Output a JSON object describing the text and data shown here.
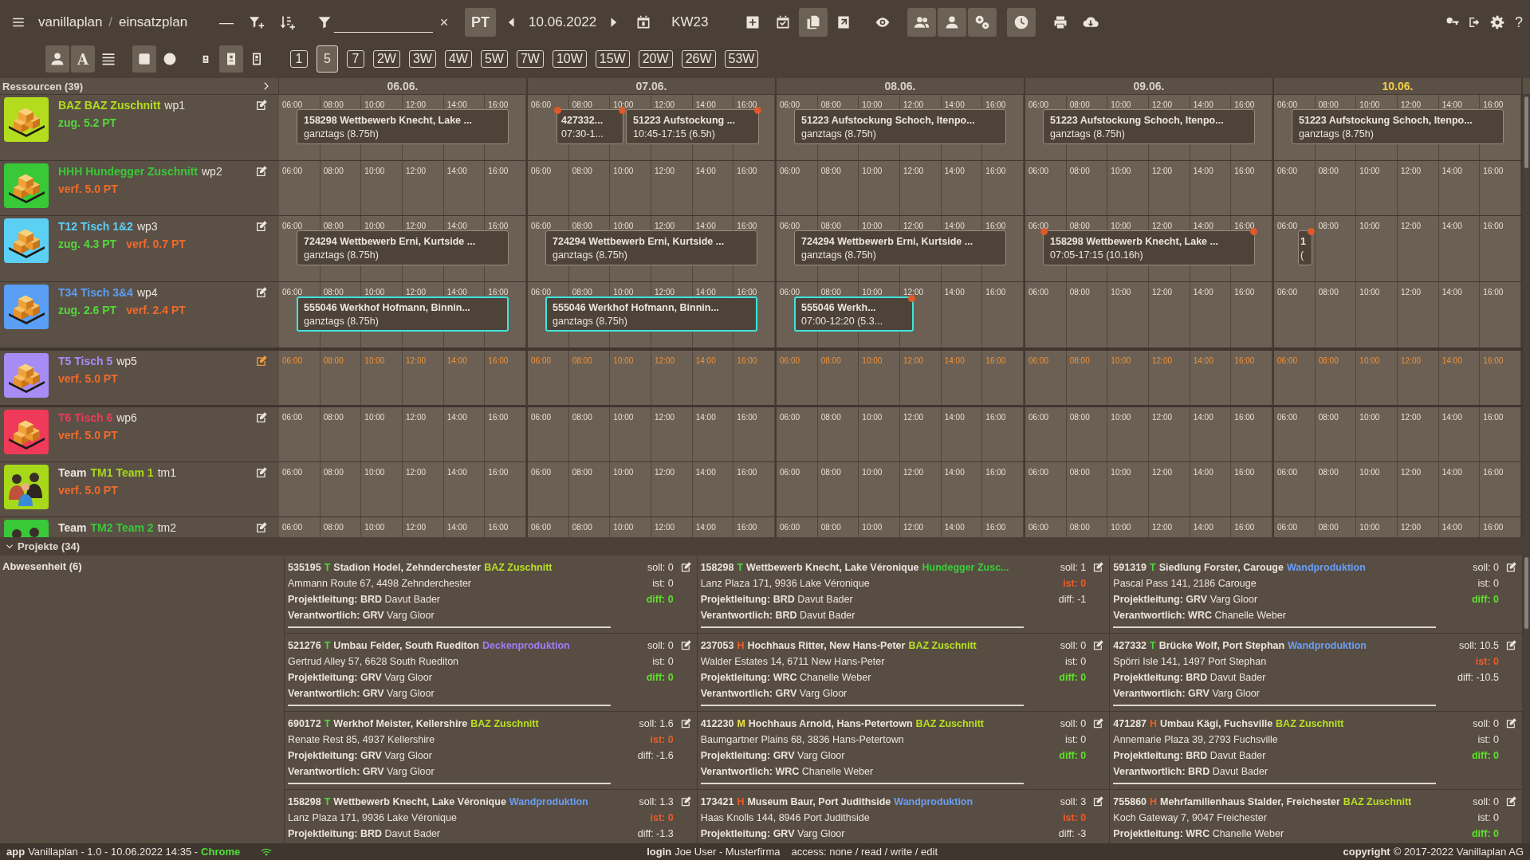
{
  "toolbar": {
    "breadcrumb": [
      "vanillaplan",
      "einsatzplan"
    ],
    "separator": "/",
    "collapse": "—",
    "clear": "×",
    "pt_button": {
      "label": "PT",
      "selected": true
    },
    "date": "10.06.2022",
    "week": "KW23",
    "tools": [
      {
        "kind": "plus-square",
        "selected": false
      },
      {
        "kind": "task-calendar",
        "selected": false
      },
      {
        "kind": "copy",
        "selected": true
      },
      {
        "kind": "share-square",
        "selected": false
      },
      {
        "kind": "eye",
        "selected": false
      },
      {
        "kind": "users",
        "selected": true
      },
      {
        "kind": "user",
        "selected": true
      },
      {
        "kind": "gears",
        "selected": true
      },
      {
        "kind": "clock",
        "selected": true
      },
      {
        "kind": "printer",
        "selected": false
      },
      {
        "kind": "cloud-download",
        "selected": false
      }
    ],
    "help": "?",
    "views": [
      {
        "kind": "user",
        "selected": true
      },
      {
        "kind": "letter",
        "label": "A",
        "selected": true
      },
      {
        "kind": "lines",
        "selected": false
      },
      {
        "kind": "square",
        "selected": true
      },
      {
        "kind": "circle",
        "selected": false
      },
      {
        "kind": "badge-small",
        "selected": false
      },
      {
        "kind": "badge",
        "selected": true
      },
      {
        "kind": "badge-outline",
        "selected": false
      }
    ],
    "ranges": [
      {
        "label": "1",
        "selected": false
      },
      {
        "label": "5",
        "selected": true
      },
      {
        "label": "7",
        "selected": false
      },
      {
        "label": "2W",
        "selected": false
      },
      {
        "label": "3W",
        "selected": false
      },
      {
        "label": "4W",
        "selected": false
      },
      {
        "label": "5W",
        "selected": false
      },
      {
        "label": "7W",
        "selected": false
      },
      {
        "label": "10W",
        "selected": false
      },
      {
        "label": "15W",
        "selected": false
      },
      {
        "label": "20W",
        "selected": false
      },
      {
        "label": "26W",
        "selected": false
      },
      {
        "label": "53W",
        "selected": false
      }
    ]
  },
  "schedule": {
    "resources_title": "Ressourcen (39)",
    "days": [
      {
        "label": "06.06.",
        "today": false
      },
      {
        "label": "07.06.",
        "today": false
      },
      {
        "label": "08.06.",
        "today": false
      },
      {
        "label": "09.06.",
        "today": false
      },
      {
        "label": "10.06.",
        "today": true
      }
    ],
    "resources": [
      {
        "kind": "pallet",
        "name": "BAZ BAZ Zuschnitt",
        "id": "wp1",
        "color": "#b3dc1e",
        "highlighted": false,
        "stats": [
          {
            "text": "zug. 5.2 PT",
            "kind": "zug"
          }
        ],
        "cells": [
          {
            "times": [
              "06:00",
              "08:00",
              "10:00",
              "12:00",
              "14:00",
              "16:00"
            ],
            "bookings": [
              {
                "title": "158298 Wettbewerb Knecht, Lake ...",
                "time": "ganztags (8.75h)",
                "kind": "full",
                "selected": false,
                "conflict_start": false,
                "conflict_end": false
              }
            ]
          },
          {
            "times": [
              "06:00",
              "08:00",
              "10:00",
              "12:00",
              "14:00",
              "16:00"
            ],
            "bookings": [
              {
                "title": "427332...",
                "time": "07:30-1...",
                "kind": "narrow",
                "selected": false,
                "conflict_start": true,
                "conflict_end": true
              },
              {
                "title": "51223 Aufstockung ...",
                "time": "10:45-17:15 (6.5h)",
                "kind": "wide",
                "selected": false,
                "conflict_start": false,
                "conflict_end": true
              }
            ]
          },
          {
            "times": [
              "06:00",
              "08:00",
              "10:00",
              "12:00",
              "14:00",
              "16:00"
            ],
            "bookings": [
              {
                "title": "51223 Aufstockung Schoch, Itenpo...",
                "time": "ganztags (8.75h)",
                "kind": "full",
                "selected": false,
                "conflict_start": false,
                "conflict_end": false
              }
            ]
          },
          {
            "times": [
              "06:00",
              "08:00",
              "10:00",
              "12:00",
              "14:00",
              "16:00"
            ],
            "bookings": [
              {
                "title": "51223 Aufstockung Schoch, Itenpo...",
                "time": "ganztags (8.75h)",
                "kind": "full",
                "selected": false,
                "conflict_start": false,
                "conflict_end": false
              }
            ]
          },
          {
            "times": [
              "06:00",
              "08:00",
              "10:00",
              "12:00",
              "14:00",
              "16:00"
            ],
            "bookings": [
              {
                "title": "51223 Aufstockung Schoch, Itenpo...",
                "time": "ganztags (8.75h)",
                "kind": "full",
                "selected": false,
                "conflict_start": false,
                "conflict_end": false
              }
            ]
          }
        ]
      },
      {
        "kind": "pallet",
        "name": "HHH Hundegger Zuschnitt",
        "id": "wp2",
        "color": "#38c838",
        "highlighted": false,
        "stats": [
          {
            "text": "verf. 5.0 PT",
            "kind": "verf"
          }
        ],
        "cells": [
          {
            "times": [
              "06:00",
              "08:00",
              "10:00",
              "12:00",
              "14:00",
              "16:00"
            ]
          },
          {
            "times": [
              "06:00",
              "08:00",
              "10:00",
              "12:00",
              "14:00",
              "16:00"
            ]
          },
          {
            "times": [
              "06:00",
              "08:00",
              "10:00",
              "12:00",
              "14:00",
              "16:00"
            ]
          },
          {
            "times": [
              "06:00",
              "08:00",
              "10:00",
              "12:00",
              "14:00",
              "16:00"
            ]
          },
          {
            "times": [
              "06:00",
              "08:00",
              "10:00",
              "12:00",
              "14:00",
              "16:00"
            ]
          }
        ]
      },
      {
        "kind": "pallet",
        "name": "T12 Tisch 1&2",
        "id": "wp3",
        "color": "#5ccff5",
        "highlighted": false,
        "stats": [
          {
            "text": "zug. 4.3 PT",
            "kind": "zug"
          },
          {
            "text": "verf. 0.7 PT",
            "kind": "verf"
          }
        ],
        "cells": [
          {
            "times": [
              "06:00",
              "08:00",
              "10:00",
              "12:00",
              "14:00",
              "16:00"
            ],
            "bookings": [
              {
                "title": "724294 Wettbewerb Erni, Kurtside ...",
                "time": "ganztags (8.75h)",
                "kind": "full",
                "selected": false,
                "conflict_start": false,
                "conflict_end": false
              }
            ]
          },
          {
            "times": [
              "06:00",
              "08:00",
              "10:00",
              "12:00",
              "14:00",
              "16:00"
            ],
            "bookings": [
              {
                "title": "724294 Wettbewerb Erni, Kurtside ...",
                "time": "ganztags (8.75h)",
                "kind": "full",
                "selected": false,
                "conflict_start": false,
                "conflict_end": false
              }
            ]
          },
          {
            "times": [
              "06:00",
              "08:00",
              "10:00",
              "12:00",
              "14:00",
              "16:00"
            ],
            "bookings": [
              {
                "title": "724294 Wettbewerb Erni, Kurtside ...",
                "time": "ganztags (8.75h)",
                "kind": "full",
                "selected": false,
                "conflict_start": false,
                "conflict_end": false
              }
            ]
          },
          {
            "times": [
              "06:00",
              "08:00",
              "10:00",
              "12:00",
              "14:00",
              "16:00"
            ],
            "bookings": [
              {
                "title": "158298 Wettbewerb Knecht, Lake ...",
                "time": "07:05-17:15 (10.16h)",
                "kind": "full",
                "selected": false,
                "conflict_start": true,
                "conflict_end": true
              }
            ]
          },
          {
            "times": [
              "06:00",
              "08:00",
              "10:00",
              "12:00",
              "14:00",
              "16:00"
            ],
            "bookings": [
              {
                "title": "1",
                "time": "(",
                "kind": "tiny",
                "selected": false,
                "conflict_start": false,
                "conflict_end": true
              }
            ]
          }
        ]
      },
      {
        "kind": "pallet",
        "name": "T34 Tisch 3&4",
        "id": "wp4",
        "color": "#5a9ef5",
        "highlighted": false,
        "stats": [
          {
            "text": "zug. 2.6 PT",
            "kind": "zug"
          },
          {
            "text": "verf. 2.4 PT",
            "kind": "verf"
          }
        ],
        "cells": [
          {
            "times": [
              "06:00",
              "08:00",
              "10:00",
              "12:00",
              "14:00",
              "16:00"
            ],
            "bookings": [
              {
                "title": "555046 Werkhof Hofmann, Binnin...",
                "time": "ganztags (8.75h)",
                "kind": "full",
                "selected": true,
                "conflict_start": false,
                "conflict_end": false
              }
            ]
          },
          {
            "times": [
              "06:00",
              "08:00",
              "10:00",
              "12:00",
              "14:00",
              "16:00"
            ],
            "bookings": [
              {
                "title": "555046 Werkhof Hofmann, Binnin...",
                "time": "ganztags (8.75h)",
                "kind": "full",
                "selected": true,
                "conflict_start": false,
                "conflict_end": false
              }
            ]
          },
          {
            "times": [
              "06:00",
              "08:00",
              "10:00",
              "12:00",
              "14:00",
              "16:00"
            ],
            "bookings": [
              {
                "title": "555046 Werkh...",
                "time": "07:00-12:20 (5.3...",
                "kind": "short",
                "selected": true,
                "conflict_start": false,
                "conflict_end": true
              }
            ]
          },
          {
            "times": [
              "06:00",
              "08:00",
              "10:00",
              "12:00",
              "14:00",
              "16:00"
            ]
          },
          {
            "times": [
              "06:00",
              "08:00",
              "10:00",
              "12:00",
              "14:00",
              "16:00"
            ]
          }
        ]
      },
      {
        "kind": "pallet",
        "name": "T5 Tisch 5",
        "id": "wp5",
        "color": "#a68df5",
        "highlighted": true,
        "stats": [
          {
            "text": "verf. 5.0 PT",
            "kind": "verf"
          }
        ],
        "cells": [
          {
            "times": [
              "06:00",
              "08:00",
              "10:00",
              "12:00",
              "14:00",
              "16:00"
            ]
          },
          {
            "times": [
              "06:00",
              "08:00",
              "10:00",
              "12:00",
              "14:00",
              "16:00"
            ]
          },
          {
            "times": [
              "06:00",
              "08:00",
              "10:00",
              "12:00",
              "14:00",
              "16:00"
            ]
          },
          {
            "times": [
              "06:00",
              "08:00",
              "10:00",
              "12:00",
              "14:00",
              "16:00"
            ]
          },
          {
            "times": [
              "06:00",
              "08:00",
              "10:00",
              "12:00",
              "14:00",
              "16:00"
            ]
          }
        ]
      },
      {
        "kind": "pallet",
        "name": "T6 Tisch 6",
        "id": "wp6",
        "color": "#f03a5a",
        "highlighted": false,
        "stats": [
          {
            "text": "verf. 5.0 PT",
            "kind": "verf"
          }
        ],
        "cells": [
          {
            "times": [
              "06:00",
              "08:00",
              "10:00",
              "12:00",
              "14:00",
              "16:00"
            ]
          },
          {
            "times": [
              "06:00",
              "08:00",
              "10:00",
              "12:00",
              "14:00",
              "16:00"
            ]
          },
          {
            "times": [
              "06:00",
              "08:00",
              "10:00",
              "12:00",
              "14:00",
              "16:00"
            ]
          },
          {
            "times": [
              "06:00",
              "08:00",
              "10:00",
              "12:00",
              "14:00",
              "16:00"
            ]
          },
          {
            "times": [
              "06:00",
              "08:00",
              "10:00",
              "12:00",
              "14:00",
              "16:00"
            ]
          }
        ]
      },
      {
        "kind": "team",
        "prefix": "Team",
        "name": "TM1 Team 1",
        "id": "tm1",
        "color": "#a8d81a",
        "highlighted": false,
        "stats": [
          {
            "text": "verf. 5.0 PT",
            "kind": "verf"
          }
        ],
        "cells": [
          {
            "times": [
              "06:00",
              "08:00",
              "10:00",
              "12:00",
              "14:00",
              "16:00"
            ]
          },
          {
            "times": [
              "06:00",
              "08:00",
              "10:00",
              "12:00",
              "14:00",
              "16:00"
            ]
          },
          {
            "times": [
              "06:00",
              "08:00",
              "10:00",
              "12:00",
              "14:00",
              "16:00"
            ]
          },
          {
            "times": [
              "06:00",
              "08:00",
              "10:00",
              "12:00",
              "14:00",
              "16:00"
            ]
          },
          {
            "times": [
              "06:00",
              "08:00",
              "10:00",
              "12:00",
              "14:00",
              "16:00"
            ]
          }
        ]
      },
      {
        "kind": "team",
        "prefix": "Team",
        "name": "TM2 Team 2",
        "id": "tm2",
        "color": "#38c838",
        "highlighted": false,
        "cells": [
          {
            "times": [
              "06:00",
              "08:00",
              "10:00",
              "12:00",
              "14:00",
              "16:00"
            ]
          },
          {
            "times": [
              "06:00",
              "08:00",
              "10:00",
              "12:00",
              "14:00",
              "16:00"
            ]
          },
          {
            "times": [
              "06:00",
              "08:00",
              "10:00",
              "12:00",
              "14:00",
              "16:00"
            ]
          },
          {
            "times": [
              "06:00",
              "08:00",
              "10:00",
              "12:00",
              "14:00",
              "16:00"
            ]
          },
          {
            "times": [
              "06:00",
              "08:00",
              "10:00",
              "12:00",
              "14:00",
              "16:00"
            ]
          }
        ]
      }
    ]
  },
  "projects": {
    "title": "Projekte (34)",
    "absence": "Abwesenheit (6)",
    "cards": [
      {
        "number": "535195",
        "type": {
          "letter": "T",
          "color": "#4ed83a"
        },
        "title": "Stadion Hodel, Zehnderchester",
        "dept": {
          "label": "BAZ Zuschnitt",
          "color": "#b8e022"
        },
        "soll": "soll: 0",
        "ist": {
          "text": "ist: 0",
          "kind": "plain"
        },
        "diff": {
          "text": "diff: 0",
          "kind": "ok"
        },
        "lines": [
          "Ammann Route 67, 4498 Zehnderchester",
          "**Projektleitung: BRD** Davut Bader",
          "**Verantwortlich: GRV** Varg Gloor"
        ]
      },
      {
        "number": "158298",
        "type": {
          "letter": "T",
          "color": "#4ed83a"
        },
        "title": "Wettbewerb Knecht, Lake Véronique",
        "dept": {
          "label": "Hundegger Zusc...",
          "color": "#3ccc3c"
        },
        "soll": "soll: 1",
        "ist": {
          "text": "ist: 0",
          "kind": "alert"
        },
        "diff": {
          "text": "diff: -1",
          "kind": "plain"
        },
        "lines": [
          "Lanz Plaza 171, 9936 Lake Véronique",
          "**Projektleitung: BRD** Davut Bader",
          "**Verantwortlich: BRD** Davut Bader"
        ]
      },
      {
        "number": "591319",
        "type": {
          "letter": "T",
          "color": "#4ed83a"
        },
        "title": "Siedlung Forster, Carouge",
        "dept": {
          "label": "Wandproduktion",
          "color": "#6a9ef5"
        },
        "soll": "soll: 0",
        "ist": {
          "text": "ist: 0",
          "kind": "plain"
        },
        "diff": {
          "text": "diff: 0",
          "kind": "ok"
        },
        "lines": [
          "Pascal Pass 141, 2186 Carouge",
          "**Projektleitung: GRV** Varg Gloor",
          "**Verantwortlich: WRC** Chanelle Weber"
        ]
      },
      {
        "number": "521276",
        "type": {
          "letter": "T",
          "color": "#4ed83a"
        },
        "title": "Umbau Felder, South Ruediton",
        "dept": {
          "label": "Deckenproduktion",
          "color": "#a07ef5"
        },
        "soll": "soll: 0",
        "ist": {
          "text": "ist: 0",
          "kind": "plain"
        },
        "diff": {
          "text": "diff: 0",
          "kind": "ok"
        },
        "lines": [
          "Gertrud Alley 57, 6628 South Ruediton",
          "**Projektleitung: GRV** Varg Gloor",
          "**Verantwortlich: GRV** Varg Gloor"
        ]
      },
      {
        "number": "237053",
        "type": {
          "letter": "H",
          "color": "#f05a28"
        },
        "title": "Hochhaus Ritter, New Hans-Peter",
        "dept": {
          "label": "BAZ Zuschnitt",
          "color": "#b8e022"
        },
        "soll": "soll: 0",
        "ist": {
          "text": "ist: 0",
          "kind": "plain"
        },
        "diff": {
          "text": "diff: 0",
          "kind": "ok"
        },
        "lines": [
          "Walder Estates 14, 6711 New Hans-Peter",
          "**Projektleitung: WRC** Chanelle Weber",
          "**Verantwortlich: GRV** Varg Gloor"
        ]
      },
      {
        "number": "427332",
        "type": {
          "letter": "T",
          "color": "#4ed83a"
        },
        "title": "Brücke Wolf, Port Stephan",
        "dept": {
          "label": "Wandproduktion",
          "color": "#6a9ef5"
        },
        "soll": "soll: 10.5",
        "ist": {
          "text": "ist: 0",
          "kind": "alert"
        },
        "diff": {
          "text": "diff: -10.5",
          "kind": "plain"
        },
        "lines": [
          "Spörri Isle 141, 1497 Port Stephan",
          "**Projektleitung: BRD** Davut Bader",
          "**Verantwortlich: GRV** Varg Gloor"
        ]
      },
      {
        "number": "690172",
        "type": {
          "letter": "T",
          "color": "#4ed83a"
        },
        "title": "Werkhof Meister, Kellershire",
        "dept": {
          "label": "BAZ Zuschnitt",
          "color": "#b8e022"
        },
        "soll": "soll: 1.6",
        "ist": {
          "text": "ist: 0",
          "kind": "alert"
        },
        "diff": {
          "text": "diff: -1.6",
          "kind": "plain"
        },
        "lines": [
          "Renate Rest 85, 4937 Kellershire",
          "**Projektleitung: GRV** Varg Gloor",
          "**Verantwortlich: GRV** Varg Gloor"
        ]
      },
      {
        "number": "412230",
        "type": {
          "letter": "M",
          "color": "#f0e040"
        },
        "title": "Hochhaus Arnold, Hans-Petertown",
        "dept": {
          "label": "BAZ Zuschnitt",
          "color": "#b8e022"
        },
        "soll": "soll: 0",
        "ist": {
          "text": "ist: 0",
          "kind": "plain"
        },
        "diff": {
          "text": "diff: 0",
          "kind": "ok"
        },
        "lines": [
          "Baumgartner Plains 68, 3836 Hans-Petertown",
          "**Projektleitung: GRV** Varg Gloor",
          "**Verantwortlich: WRC** Chanelle Weber"
        ]
      },
      {
        "number": "471287",
        "type": {
          "letter": "H",
          "color": "#f05a28"
        },
        "title": "Umbau Kägi, Fuchsville",
        "dept": {
          "label": "BAZ Zuschnitt",
          "color": "#b8e022"
        },
        "soll": "soll: 0",
        "ist": {
          "text": "ist: 0",
          "kind": "plain"
        },
        "diff": {
          "text": "diff: 0",
          "kind": "ok"
        },
        "lines": [
          "Annemarie Plaza 39, 2793 Fuchsville",
          "**Projektleitung: BRD** Davut Bader",
          "**Verantwortlich: BRD** Davut Bader"
        ]
      },
      {
        "number": "158298",
        "type": {
          "letter": "T",
          "color": "#4ed83a"
        },
        "title": "Wettbewerb Knecht, Lake Véronique",
        "dept": {
          "label": "Wandproduktion",
          "color": "#6a9ef5"
        },
        "soll": "soll: 1.3",
        "ist": {
          "text": "ist: 0",
          "kind": "alert"
        },
        "diff": {
          "text": "diff: -1.3",
          "kind": "plain"
        },
        "lines": [
          "Lanz Plaza 171, 9936 Lake Véronique",
          "**Projektleitung: BRD** Davut Bader"
        ]
      },
      {
        "number": "173421",
        "type": {
          "letter": "H",
          "color": "#f05a28"
        },
        "title": "Museum Baur, Port Judithside",
        "dept": {
          "label": "Wandproduktion",
          "color": "#6a9ef5"
        },
        "soll": "soll: 3",
        "ist": {
          "text": "ist: 0",
          "kind": "alert"
        },
        "diff": {
          "text": "diff: -3",
          "kind": "plain"
        },
        "lines": [
          "Haas Knolls 144, 8946 Port Judithside",
          "**Projektleitung: GRV** Varg Gloor"
        ]
      },
      {
        "number": "755860",
        "type": {
          "letter": "H",
          "color": "#f05a28"
        },
        "title": "Mehrfamilienhaus Stalder, Freichester",
        "dept": {
          "label": "BAZ Zuschnitt",
          "color": "#b8e022"
        },
        "soll": "soll: 0",
        "ist": {
          "text": "ist: 0",
          "kind": "plain"
        },
        "diff": {
          "text": "diff: 0",
          "kind": "ok"
        },
        "lines": [
          "Koch Gateway 7, 9047 Freichester",
          "**Projektleitung: WRC** Chanelle Weber"
        ]
      }
    ]
  },
  "status_bar": {
    "app_label": "app",
    "app_info": "Vanillaplan - 1.0 - 10.06.2022 14:35 -",
    "browser": "Chrome",
    "login_label": "login",
    "login_info": "Joe User - Musterfirma",
    "access": "access: none / read / write / edit",
    "copyright_label": "copyright",
    "copyright_info": "© 2017-2022 Vanillaplan AG"
  }
}
